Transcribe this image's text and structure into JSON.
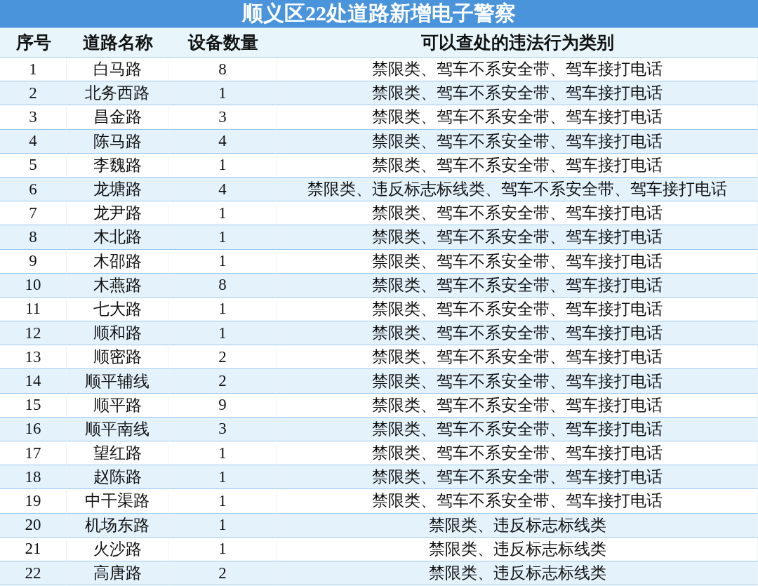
{
  "title": "顺义区22处道路新增电子警察",
  "columns": [
    "序号",
    "道路名称",
    "设备数量",
    "可以查处的违法行为类别"
  ],
  "rows": [
    {
      "no": "1",
      "road": "白马路",
      "count": "8",
      "violations": "禁限类、驾车不系安全带、驾车接打电话"
    },
    {
      "no": "2",
      "road": "北务西路",
      "count": "1",
      "violations": "禁限类、驾车不系安全带、驾车接打电话"
    },
    {
      "no": "3",
      "road": "昌金路",
      "count": "3",
      "violations": "禁限类、驾车不系安全带、驾车接打电话"
    },
    {
      "no": "4",
      "road": "陈马路",
      "count": "4",
      "violations": "禁限类、驾车不系安全带、驾车接打电话"
    },
    {
      "no": "5",
      "road": "李魏路",
      "count": "1",
      "violations": "禁限类、驾车不系安全带、驾车接打电话"
    },
    {
      "no": "6",
      "road": "龙塘路",
      "count": "4",
      "violations": "禁限类、违反标志标线类、驾车不系安全带、驾车接打电话"
    },
    {
      "no": "7",
      "road": "龙尹路",
      "count": "1",
      "violations": "禁限类、驾车不系安全带、驾车接打电话"
    },
    {
      "no": "8",
      "road": "木北路",
      "count": "1",
      "violations": "禁限类、驾车不系安全带、驾车接打电话"
    },
    {
      "no": "9",
      "road": "木邵路",
      "count": "1",
      "violations": "禁限类、驾车不系安全带、驾车接打电话"
    },
    {
      "no": "10",
      "road": "木燕路",
      "count": "8",
      "violations": "禁限类、驾车不系安全带、驾车接打电话"
    },
    {
      "no": "11",
      "road": "七大路",
      "count": "1",
      "violations": "禁限类、驾车不系安全带、驾车接打电话"
    },
    {
      "no": "12",
      "road": "顺和路",
      "count": "1",
      "violations": "禁限类、驾车不系安全带、驾车接打电话"
    },
    {
      "no": "13",
      "road": "顺密路",
      "count": "2",
      "violations": "禁限类、驾车不系安全带、驾车接打电话"
    },
    {
      "no": "14",
      "road": "顺平辅线",
      "count": "2",
      "violations": "禁限类、驾车不系安全带、驾车接打电话"
    },
    {
      "no": "15",
      "road": "顺平路",
      "count": "9",
      "violations": "禁限类、驾车不系安全带、驾车接打电话"
    },
    {
      "no": "16",
      "road": "顺平南线",
      "count": "3",
      "violations": "禁限类、驾车不系安全带、驾车接打电话"
    },
    {
      "no": "17",
      "road": "望红路",
      "count": "1",
      "violations": "禁限类、驾车不系安全带、驾车接打电话"
    },
    {
      "no": "18",
      "road": "赵陈路",
      "count": "1",
      "violations": "禁限类、驾车不系安全带、驾车接打电话"
    },
    {
      "no": "19",
      "road": "中干渠路",
      "count": "1",
      "violations": "禁限类、驾车不系安全带、驾车接打电话"
    },
    {
      "no": "20",
      "road": "机场东路",
      "count": "1",
      "violations": "禁限类、违反标志标线类"
    },
    {
      "no": "21",
      "road": "火沙路",
      "count": "1",
      "violations": "禁限类、违反标志标线类"
    },
    {
      "no": "22",
      "road": "高唐路",
      "count": "2",
      "violations": "禁限类、违反标志标线类"
    }
  ]
}
